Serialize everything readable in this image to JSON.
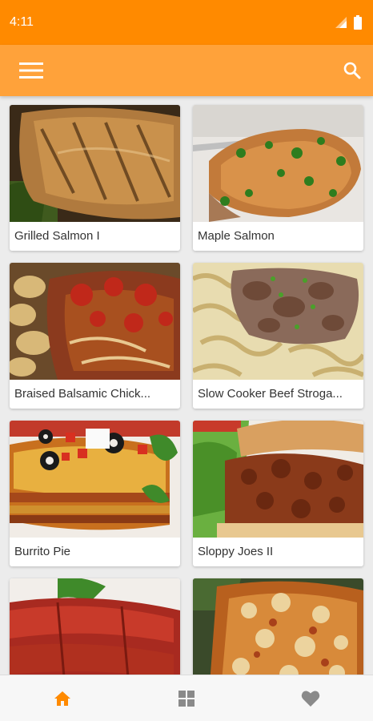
{
  "status_bar": {
    "time": "4:11"
  },
  "app_bar": {
    "menu_icon": "hamburger-menu-icon",
    "search_icon": "search-icon"
  },
  "recipes": [
    {
      "title": "Grilled Salmon I",
      "image": "grilled-salmon"
    },
    {
      "title": "Maple Salmon",
      "image": "maple-salmon"
    },
    {
      "title": "Braised Balsamic Chick...",
      "image": "braised-balsamic-chicken"
    },
    {
      "title": "Slow Cooker Beef Stroga...",
      "image": "beef-stroganoff"
    },
    {
      "title": "Burrito Pie",
      "image": "burrito-pie"
    },
    {
      "title": "Sloppy Joes II",
      "image": "sloppy-joes"
    },
    {
      "title": "",
      "image": "meatloaf"
    },
    {
      "title": "",
      "image": "lasagna"
    }
  ],
  "bottom_nav": [
    {
      "icon": "home-icon",
      "active": true
    },
    {
      "icon": "grid-icon",
      "active": false
    },
    {
      "icon": "heart-icon",
      "active": false
    }
  ],
  "colors": {
    "status_bar": "#ff8a00",
    "app_bar": "#ffa23a",
    "nav_active": "#ff8a00",
    "nav_inactive": "#8a8a8a"
  }
}
